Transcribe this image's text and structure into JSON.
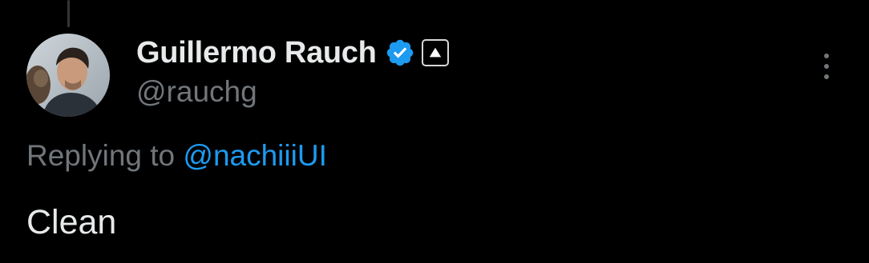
{
  "tweet": {
    "author": {
      "display_name": "Guillermo Rauch",
      "handle": "@rauchg",
      "verified_icon": "verified-badge-icon",
      "affiliate_icon": "vercel-triangle-icon"
    },
    "reply": {
      "prefix": "Replying to",
      "mention": "@nachiiiUI"
    },
    "text": "Clean",
    "more_icon": "more-vertical-icon"
  },
  "colors": {
    "background": "#000000",
    "primary_text": "#e7e9ea",
    "secondary_text": "#71767b",
    "link": "#1d9bf0",
    "verified": "#1d9bf0"
  }
}
